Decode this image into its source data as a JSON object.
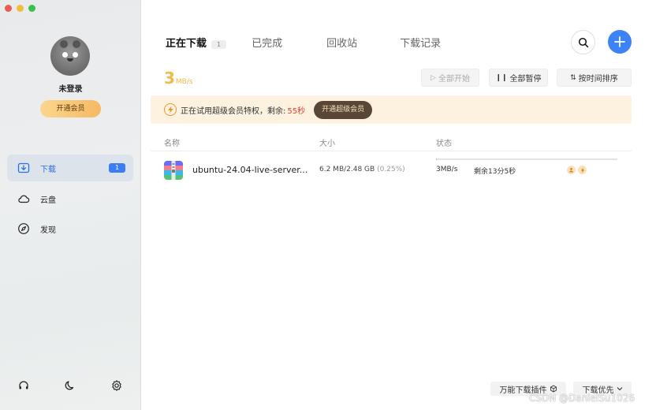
{
  "sidebar": {
    "user_name": "未登录",
    "vip_button": "开通会员",
    "nav": [
      {
        "label": "下载",
        "badge": "1",
        "icon": "download-icon"
      },
      {
        "label": "云盘",
        "icon": "cloud-icon"
      },
      {
        "label": "发现",
        "icon": "compass-icon"
      }
    ],
    "bottom_icons": [
      "headset-icon",
      "moon-icon",
      "settings-gear-icon"
    ]
  },
  "main": {
    "tabs": [
      {
        "label": "正在下载",
        "count": "1",
        "active": true
      },
      {
        "label": "已完成"
      },
      {
        "label": "回收站"
      },
      {
        "label": "下载记录"
      }
    ],
    "speed": {
      "value": "3",
      "unit": "MB/s"
    },
    "toolbar": {
      "start_all": "全部开始",
      "pause_all": "全部暂停",
      "sort_by_time": "按时间排序"
    },
    "banner": {
      "text": "正在试用超级会员特权，剩余:",
      "remaining": "55秒",
      "cta": "开通超级会员"
    },
    "table": {
      "columns": [
        "名称",
        "大小",
        "状态"
      ],
      "rows": [
        {
          "name": "ubuntu-24.04-live-server...",
          "size": "6.2 MB/2.48 GB",
          "percent": "(0.25%)",
          "progress": 0.0025,
          "speed": "3MB/s",
          "eta": "剩余13分5秒"
        }
      ]
    },
    "footer": {
      "plugin": "万能下载插件",
      "priority": "下载优先"
    }
  },
  "watermark": "CSDN @DanielSu1026",
  "colors": {
    "accent": "#3d82f6",
    "speed": "#f2b94c",
    "warning": "#e7403a",
    "banner_bg": "#fdf2df"
  }
}
